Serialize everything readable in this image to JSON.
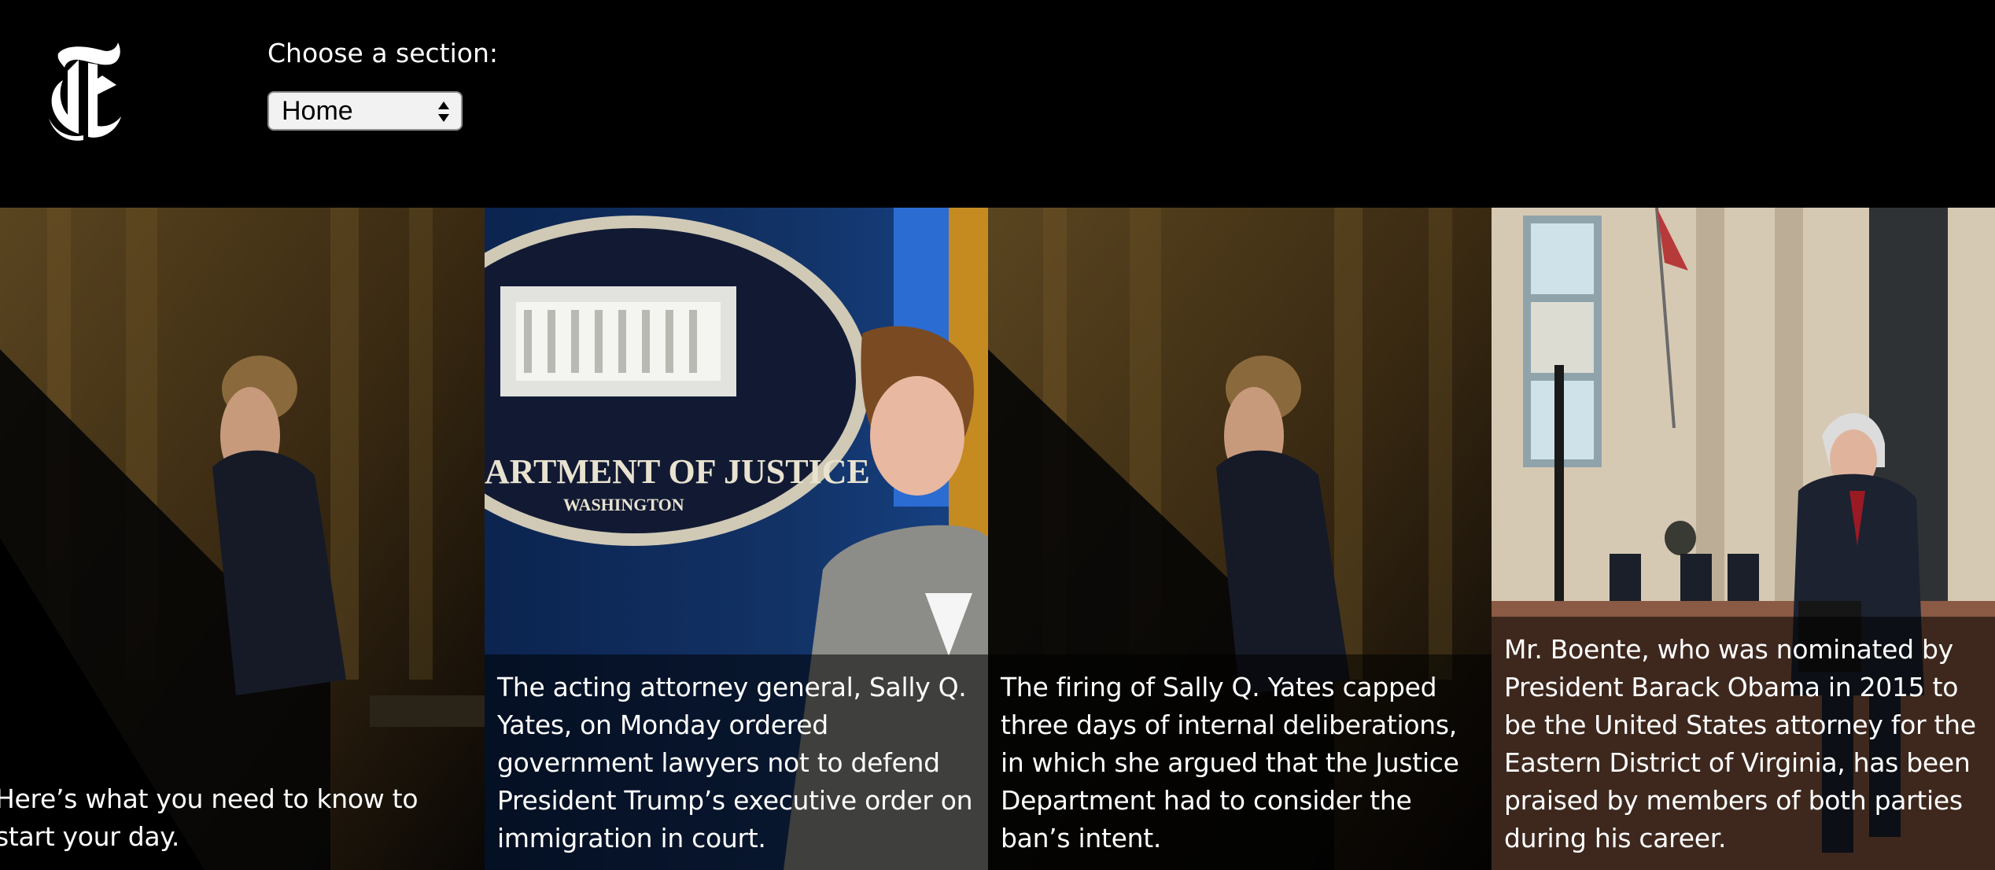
{
  "app": {
    "logo_name": "nyt-t-logo",
    "logo_glyph": "T"
  },
  "section_picker": {
    "label": "Choose a section:",
    "selected": "Home"
  },
  "stories": [
    {
      "caption": "Here’s what you need to know to start your day."
    },
    {
      "caption": "The acting attorney general, Sally Q. Yates, on Monday ordered government lawyers not to defend President Trump’s executive order on immigration in court."
    },
    {
      "caption": "The firing of Sally Q. Yates capped three days of internal deliberations, in which she argued that the Justice Department had to consider the ban’s intent."
    },
    {
      "caption": "Mr. Boente, who was nominated by President Barack Obama in 2015 to be the United States attorney for the Eastern District of Virginia, has been praised by members of both parties during his career."
    }
  ],
  "colors": {
    "background": "#000000",
    "text": "#ffffff",
    "select_bg": "#f2f2f2"
  }
}
